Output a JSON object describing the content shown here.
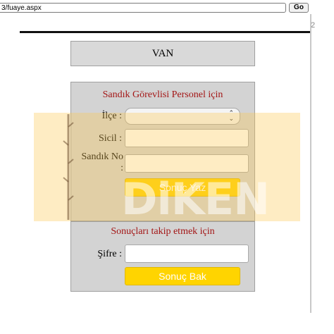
{
  "browser": {
    "url": "3/fuaye.aspx",
    "go_label": "Go",
    "edge_char": "2"
  },
  "header": {
    "city": "VAN"
  },
  "officer_form": {
    "title": "Sandık Görevlisi Personel için",
    "district_label": "İlçe :",
    "district_value": "",
    "sicil_label": "Sicil :",
    "sicil_value": "",
    "ballot_label": "Sandık No",
    "ballot_label_colon": ":",
    "ballot_value": "",
    "submit_label": "Sonuç Yaz"
  },
  "follow_form": {
    "title": "Sonuçları takip etmek için",
    "password_label": "Şifre :",
    "password_value": "",
    "submit_label": "Sonuç Bak"
  },
  "watermark": {
    "text": "DiKEN",
    "band_color": "#fdc650"
  }
}
